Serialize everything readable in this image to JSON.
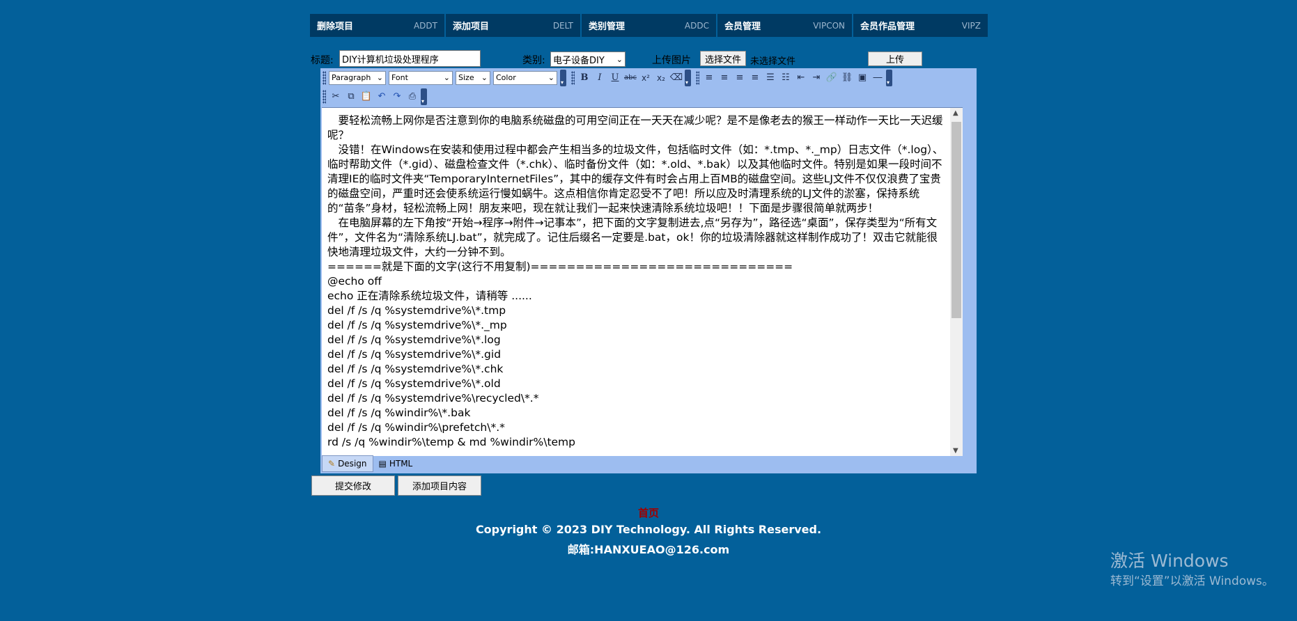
{
  "nav": [
    {
      "label": "删除项目",
      "code": "ADDT"
    },
    {
      "label": "添加项目",
      "code": "DELT"
    },
    {
      "label": "类别管理",
      "code": "ADDC"
    },
    {
      "label": "会员管理",
      "code": "VIPCON"
    },
    {
      "label": "会员作品管理",
      "code": "VIPZ"
    }
  ],
  "form": {
    "title_label": "标题:",
    "title_value": "DIY计算机垃圾处理程序",
    "category_label": "类别:",
    "category_value": "电子设备DIY",
    "upload_label": "上传图片",
    "choose_file": "选择文件",
    "no_file": "未选择文件",
    "upload_button": "上传"
  },
  "toolbar": {
    "paragraph": "Paragraph",
    "font": "Font",
    "size": "Size",
    "color": "Color"
  },
  "editor_content": [
    "　要轻松流畅上网你是否注意到你的电脑系统磁盘的可用空间正在一天天在减少呢？是不是像老去的猴王一样动作一天比一天迟缓呢？",
    "　没错！在Windows在安装和使用过程中都会产生相当多的垃圾文件，包括临时文件（如：*.tmp、*._mp）日志文件（*.log）、临时帮助文件（*.gid）、磁盘检查文件（*.chk）、临时备份文件（如：*.old、*.bak）以及其他临时文件。特别是如果一段时间不清理IE的临时文件夹“TemporaryInternetFiles”，其中的缓存文件有时会占用上百MB的磁盘空间。这些LJ文件不仅仅浪费了宝贵的磁盘空间，严重时还会使系统运行慢如蜗牛。这点相信你肯定忍受不了吧！所以应及时清理系统的LJ文件的淤塞，保持系统的“苗条”身材，轻松流畅上网！朋友来吧，现在就让我们一起来快速清除系统垃圾吧！！下面是步骤很简单就两步！",
    "　在电脑屏幕的左下角按“开始→程序→附件→记事本”，把下面的文字复制进去,点“另存为”，路径选“桌面”，保存类型为“所有文件”，文件名为“清除系统LJ.bat”，就完成了。记住后缀名一定要是.bat，ok！你的垃圾清除器就这样制作成功了！双击它就能很快地清理垃圾文件，大约一分钟不到。",
    "======就是下面的文字(这行不用复制)=============================",
    "@echo off",
    "echo 正在清除系统垃圾文件，请稍等 ......",
    "del /f /s /q %systemdrive%\\*.tmp",
    "del /f /s /q %systemdrive%\\*._mp",
    "del /f /s /q %systemdrive%\\*.log",
    "del /f /s /q %systemdrive%\\*.gid",
    "del /f /s /q %systemdrive%\\*.chk",
    "del /f /s /q %systemdrive%\\*.old",
    "del /f /s /q %systemdrive%\\recycled\\*.*",
    "del /f /s /q %windir%\\*.bak",
    "del /f /s /q %windir%\\prefetch\\*.*",
    "rd /s /q %windir%\\temp & md %windir%\\temp"
  ],
  "editor_tabs": {
    "design": "Design",
    "html": "HTML"
  },
  "buttons": {
    "submit": "提交修改",
    "add": "添加项目内容"
  },
  "footer": {
    "home": "首页",
    "copyright": "Copyright © 2023 DIY Technology. All Rights Reserved.",
    "email": "邮箱:HANXUEAO@126.com"
  },
  "watermark": {
    "line1": "激活 Windows",
    "line2": "转到“设置”以激活 Windows。"
  }
}
